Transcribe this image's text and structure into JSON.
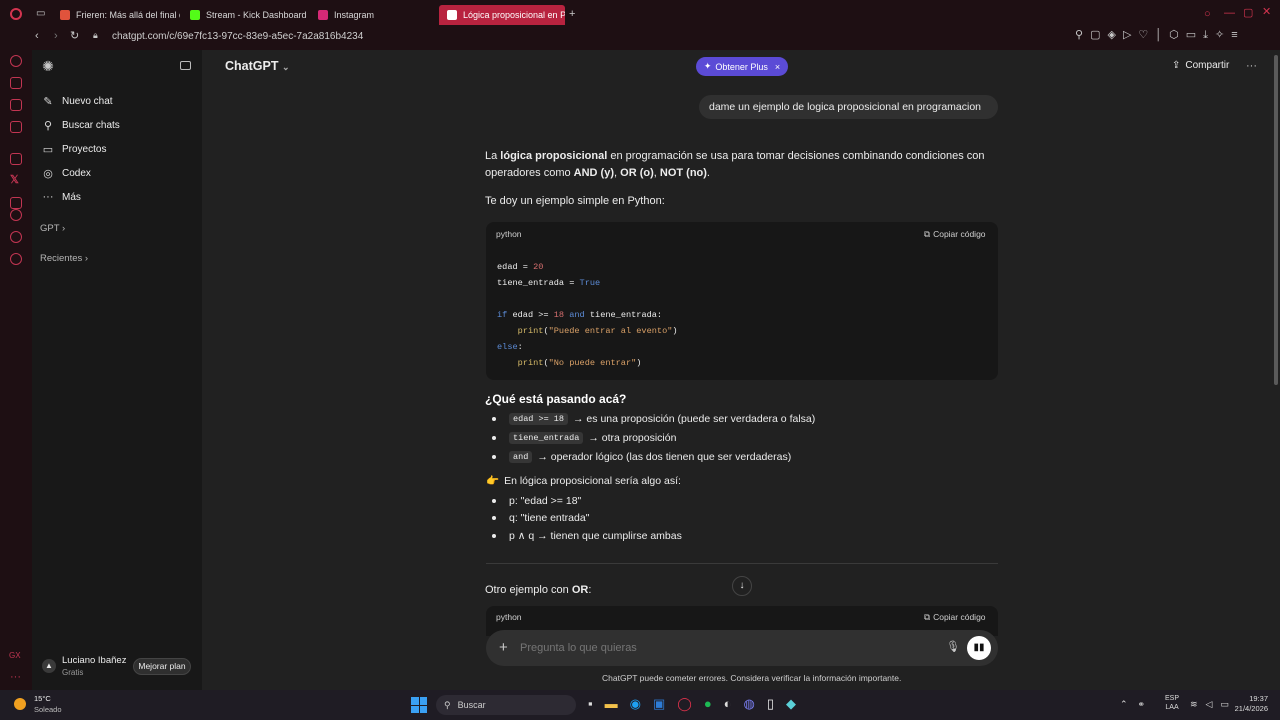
{
  "browser": {
    "tabs": [
      {
        "label": "Frieren: Más allá del final d",
        "color": "#e0533c"
      },
      {
        "label": "Stream - Kick Dashboard",
        "color": "#53fc18"
      },
      {
        "label": "Instagram",
        "color": "#d62976"
      },
      {
        "label": "Lógica proposicional en P",
        "color": "#ffffff"
      }
    ],
    "url": "chatgpt.com/c/69e7fc13-97cc-83e9-a5ec-7a2a816b4234"
  },
  "sidebar": {
    "items": [
      {
        "label": "Nuevo chat",
        "icon": "edit-icon"
      },
      {
        "label": "Buscar chats",
        "icon": "search-icon"
      },
      {
        "label": "Proyectos",
        "icon": "folder-icon"
      },
      {
        "label": "Codex",
        "icon": "codex-icon"
      },
      {
        "label": "Más",
        "icon": "more-icon"
      }
    ],
    "groups": [
      "GPT",
      "Recientes"
    ],
    "user": {
      "name": "Luciano Ibañez",
      "plan": "Gratis",
      "upgrade": "Mejorar plan"
    }
  },
  "header": {
    "model": "ChatGPT",
    "plus_button": "Obtener Plus",
    "share": "Compartir"
  },
  "chat": {
    "user_message": "dame un ejemplo de logica proposicional en programacion",
    "p1_a": "La ",
    "p1_b": "lógica proposicional",
    "p1_c": " en programación se usa para tomar decisiones combinando condiciones con",
    "p1_d": "operadores como ",
    "p1_e": "AND (y)",
    "p1_f": ", ",
    "p1_g": "OR (o)",
    "p1_h": ", ",
    "p1_i": "NOT (no)",
    "p1_j": ".",
    "p2": "Te doy un ejemplo simple en Python:",
    "code_lang": "python",
    "copy_label": "Copiar código",
    "code": {
      "l1a": "edad",
      "l1b": " = ",
      "l1c": "20",
      "l2a": "tiene_entrada",
      "l2b": " = ",
      "l2c": "True",
      "l3a": "if",
      "l3b": " edad >= ",
      "l3c": "18",
      "l3d": " and",
      "l3e": " tiene_entrada:",
      "l4a": "print",
      "l4b": "(",
      "l4c": "\"Puede entrar al evento\"",
      "l4d": ")",
      "l5a": "else",
      "l5b": ":",
      "l6a": "print",
      "l6b": "(",
      "l6c": "\"No puede entrar\"",
      "l6d": ")"
    },
    "heading": "¿Qué está pasando acá?",
    "bullets1": [
      {
        "code": "edad >= 18",
        "text": "→ es una proposición (puede ser verdadera o falsa)"
      },
      {
        "code": "tiene_entrada",
        "text": "→ otra proposición"
      },
      {
        "code": "and",
        "text": "→ operador lógico (las dos tienen que ser verdaderas)"
      }
    ],
    "hint_emoji": "👉",
    "hint": "En lógica proposicional sería algo así:",
    "bullets2": [
      "p: \"edad >= 18\"",
      "q: \"tiene entrada\"",
      "p ∧ q → tienen que cumplirse ambas"
    ],
    "p3_a": "Otro ejemplo con ",
    "p3_b": "OR",
    "p3_c": ":",
    "code2_lang": "python",
    "copy2_label": "Copiar código"
  },
  "composer": {
    "placeholder": "Pregunta lo que quieras",
    "disclaimer": "ChatGPT puede cometer errores. Considera verificar la información importante."
  },
  "taskbar": {
    "weather_temp": "15°C",
    "weather_desc": "Soleado",
    "search": "Buscar",
    "lang1": "ESP",
    "lang2": "LAA",
    "time": "19:37",
    "date": "21/4/2026"
  },
  "colors": {
    "accent_purple": "#5b4bd6",
    "opera_red": "#b8233f"
  }
}
